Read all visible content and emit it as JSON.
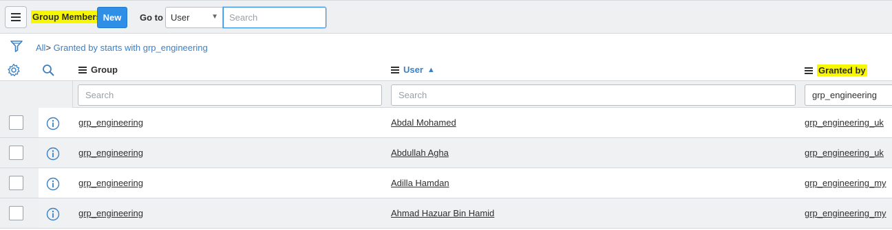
{
  "header": {
    "title": "Group Members",
    "new_label": "New",
    "goto_label": "Go to",
    "goto_selected": "User",
    "search_placeholder": "Search"
  },
  "breadcrumb": {
    "all": "All",
    "separator": ">",
    "condition": "Granted by starts with grp_engineering"
  },
  "columns": {
    "group": "Group",
    "user": "User",
    "granted_by": "Granted by",
    "user_sort": "▲"
  },
  "filters": {
    "group_placeholder": "Search",
    "user_placeholder": "Search",
    "granted_by_value": "grp_engineering"
  },
  "rows": [
    {
      "group": "grp_engineering",
      "user": "Abdal Mohamed",
      "granted_by": "grp_engineering_uk"
    },
    {
      "group": "grp_engineering",
      "user": "Abdullah Agha",
      "granted_by": "grp_engineering_uk"
    },
    {
      "group": "grp_engineering",
      "user": "Adilla Hamdan",
      "granted_by": "grp_engineering_my"
    },
    {
      "group": "grp_engineering",
      "user": "Ahmad Hazuar Bin Hamid",
      "granted_by": "grp_engineering_my"
    }
  ],
  "colors": {
    "accent": "#2f8ee5",
    "link": "#3b7fc4",
    "highlight": "#f7f700"
  }
}
